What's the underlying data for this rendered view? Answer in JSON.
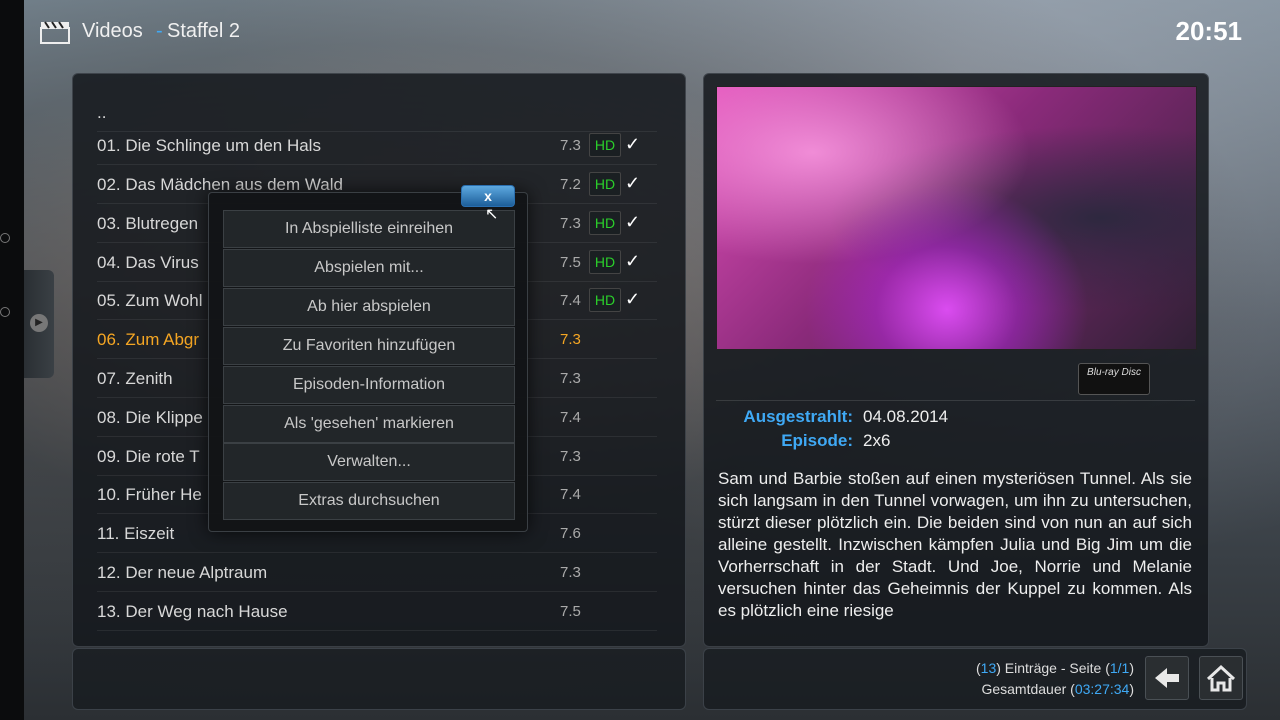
{
  "header": {
    "title": "Videos",
    "separator": "-",
    "subtitle": "Staffel 2",
    "clock": "20:51"
  },
  "list": {
    "parent_label": "..",
    "items": [
      {
        "label": "01. Die Schlinge um den Hals",
        "rating": "7.3",
        "hd": "HD",
        "watched": "✓"
      },
      {
        "label": "02. Das Mädchen aus dem Wald",
        "rating": "7.2",
        "hd": "HD",
        "watched": "✓"
      },
      {
        "label": "03. Blutregen",
        "rating": "7.3",
        "hd": "HD",
        "watched": "✓"
      },
      {
        "label": "04. Das Virus",
        "rating": "7.5",
        "hd": "HD",
        "watched": "✓"
      },
      {
        "label": "05. Zum Wohl",
        "rating": "7.4",
        "hd": "HD",
        "watched": "✓"
      },
      {
        "label": "06. Zum Abgr",
        "rating": "7.3"
      },
      {
        "label": "07. Zenith",
        "rating": "7.3"
      },
      {
        "label": "08. Die Klippe",
        "rating": "7.4"
      },
      {
        "label": "09. Die rote T",
        "rating": "7.3"
      },
      {
        "label": "10. Früher He",
        "rating": "7.4"
      },
      {
        "label": "11. Eiszeit",
        "rating": "7.6"
      },
      {
        "label": "12. Der neue Alptraum",
        "rating": "7.3"
      },
      {
        "label": "13. Der Weg nach Hause",
        "rating": "7.5"
      }
    ]
  },
  "context_menu": {
    "close_label": "x",
    "items": [
      "In Abspielliste einreihen",
      "Abspielen mit...",
      "Ab hier abspielen",
      "Zu Favoriten hinzufügen",
      "Episoden-Information",
      "Als 'gesehen' markieren",
      "Verwalten...",
      "Extras durchsuchen"
    ]
  },
  "info": {
    "media_flag": "Blu-ray Disc",
    "aired_label": "Ausgestrahlt:",
    "aired_value": "04.08.2014",
    "episode_label": "Episode:",
    "episode_value": "2x6",
    "plot": "Sam und Barbie stoßen auf einen mysteriösen Tunnel. Als sie sich langsam in den Tunnel vorwagen, um ihn zu untersuchen, stürzt dieser plötzlich ein. Die beiden sind von nun an auf sich alleine gestellt. Inzwischen kämpfen Julia und Big Jim um die Vorherrschaft in der Stadt. Und Joe, Norrie und Melanie versuchen hinter das Geheimnis der Kuppel zu kommen. Als es plötzlich eine riesige"
  },
  "footer": {
    "count": "13",
    "count_suffix": ") Einträge - Seite (",
    "page": "1/1",
    "duration_label": "Gesamtdauer (",
    "duration": "03:27:34",
    "close_paren": ")",
    "open_paren": "("
  },
  "colors": {
    "accent": "#3fa9f5",
    "selected": "#f5a623",
    "hd": "#2bd02b"
  }
}
